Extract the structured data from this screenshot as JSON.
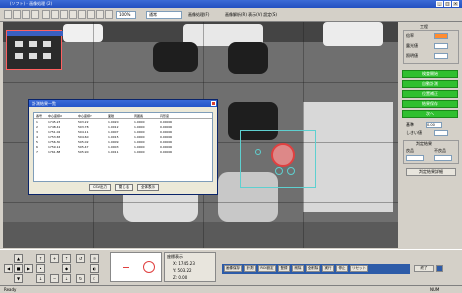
{
  "window": {
    "title": "(ソフト) - 画像処理 (2)",
    "controls": [
      "_",
      "□",
      "×"
    ]
  },
  "toolbar": {
    "zoom_select": "100%",
    "mode_select": "通常",
    "link1": "画像処理(F)",
    "link2": "画像解析(R)  表示(V)  設定(S)"
  },
  "dialog": {
    "title": "計測結果一覧",
    "columns": [
      "番号",
      "中心座標X",
      "中心座標Y",
      "面積",
      "周囲長",
      "円形度"
    ],
    "rows": [
      [
        "1",
        "1745.23",
        "503.22",
        "1.0020",
        "1.0000",
        "0.00000"
      ],
      [
        "2",
        "1748.41",
        "503.78",
        "1.0012",
        "1.0000",
        "0.00000"
      ],
      [
        "3",
        "1751.02",
        "504.11",
        "1.0007",
        "1.0000",
        "0.00000"
      ],
      [
        "4",
        "1753.65",
        "504.60",
        "1.0015",
        "1.0000",
        "0.00000"
      ],
      [
        "5",
        "1756.30",
        "505.02",
        "1.0009",
        "1.0000",
        "0.00000"
      ],
      [
        "6",
        "1759.12",
        "505.47",
        "1.0003",
        "1.0000",
        "0.00000"
      ],
      [
        "7",
        "1761.88",
        "505.90",
        "1.0011",
        "1.0000",
        "0.00000"
      ]
    ],
    "buttons": [
      "CSV出力",
      "閉じる",
      "全体表示"
    ]
  },
  "right_panel": {
    "header": "工程",
    "fields": [
      {
        "label": "倍率",
        "value": ""
      },
      {
        "label": "露光値",
        "value": ""
      },
      {
        "label": "照明値",
        "value": ""
      }
    ],
    "green_buttons": [
      "検査開始",
      "自動計測",
      "位置補正",
      "結果保存",
      "次へ"
    ],
    "settings_label": "基準",
    "settings_value": "0.00",
    "threshold_label": "しきい値",
    "result_header": "判定結果",
    "result_row": [
      "良品",
      "不良品"
    ],
    "result_button": "判定結果詳細"
  },
  "bottom": {
    "coord_label": "座標表示",
    "coord_x": "X: 1745.23",
    "coord_y": "Y: 503.22",
    "coord_z": "Z: 0.00",
    "buttons": [
      "画像保存",
      "計測",
      "ROI設定",
      "登録",
      "削除",
      "全削除",
      "実行",
      "停止",
      "リセット",
      "終了"
    ]
  },
  "statusbar": {
    "left": "Ready",
    "right": "NUM"
  },
  "colors": {
    "accent": "#2fc02f",
    "title": "#2350c0",
    "roi": "#5ed0d0"
  }
}
